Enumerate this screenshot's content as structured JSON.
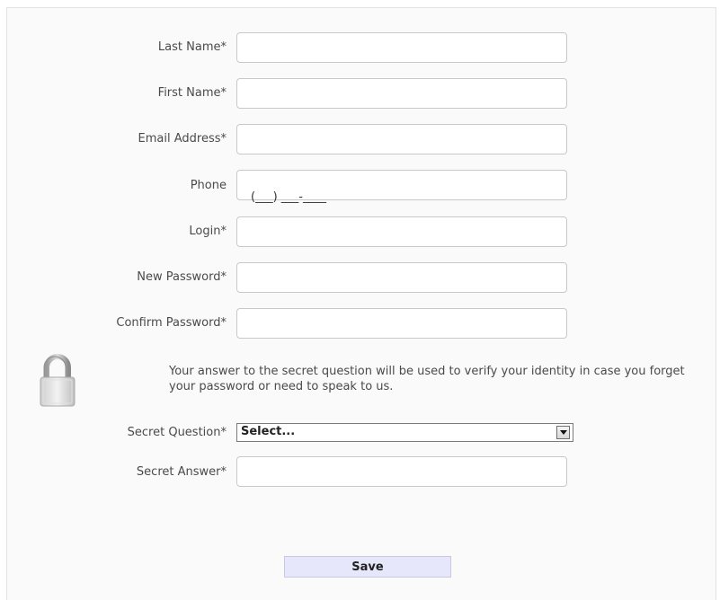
{
  "form": {
    "last_name": {
      "label": "Last Name*",
      "value": ""
    },
    "first_name": {
      "label": "First Name*",
      "value": ""
    },
    "email": {
      "label": "Email Address*",
      "value": ""
    },
    "phone": {
      "label": "Phone",
      "mask": "(___) ___-____"
    },
    "login": {
      "label": "Login*",
      "value": ""
    },
    "new_password": {
      "label": "New Password*",
      "value": ""
    },
    "confirm_password": {
      "label": "Confirm Password*",
      "value": ""
    },
    "secret_info": "Your answer to the secret question will be used to verify your identity in case you forget your password or need to speak to us.",
    "secret_question": {
      "label": "Secret Question*",
      "selected": "Select..."
    },
    "secret_answer": {
      "label": "Secret Answer*",
      "value": ""
    },
    "save_label": "Save"
  },
  "icons": {
    "lock": "lock-icon",
    "dropdown": "chevron-down-icon"
  },
  "colors": {
    "panel_bg": "#fafafa",
    "button_bg": "#e7e7fb",
    "field_border": "#c8c8c8"
  }
}
